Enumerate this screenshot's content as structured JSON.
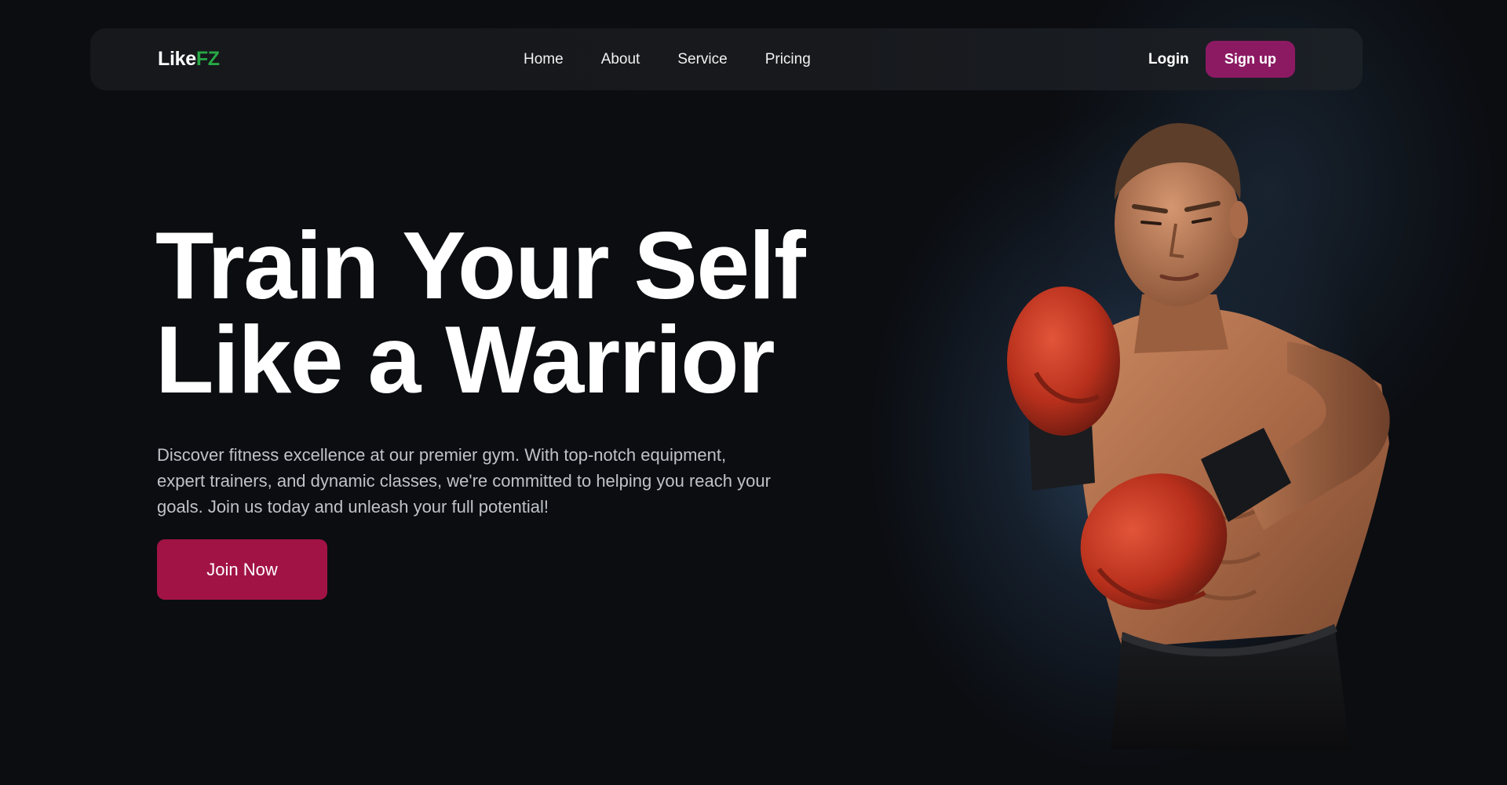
{
  "brand": {
    "logo_part1": "Like",
    "logo_part2": "FZ",
    "logo_part2_color": "#27a845"
  },
  "nav": {
    "links": [
      "Home",
      "About",
      "Service",
      "Pricing"
    ],
    "login_label": "Login",
    "signup_label": "Sign up",
    "signup_color": "#8c1a63"
  },
  "hero": {
    "title_line1": "Train Your Self",
    "title_line2": "Like a Warrior",
    "description_lines": [
      "Discover fitness excellence at our premier gym. With top-notch equipment,",
      "expert trainers, and dynamic classes, we're committed to helping you reach your",
      "goals. Join us today and unleash your full potential!"
    ],
    "cta_label": "Join Now",
    "cta_color": "#a11345"
  },
  "colors": {
    "background": "#0b0d11",
    "navbar": "#16181c",
    "glove": "#c9351c"
  }
}
